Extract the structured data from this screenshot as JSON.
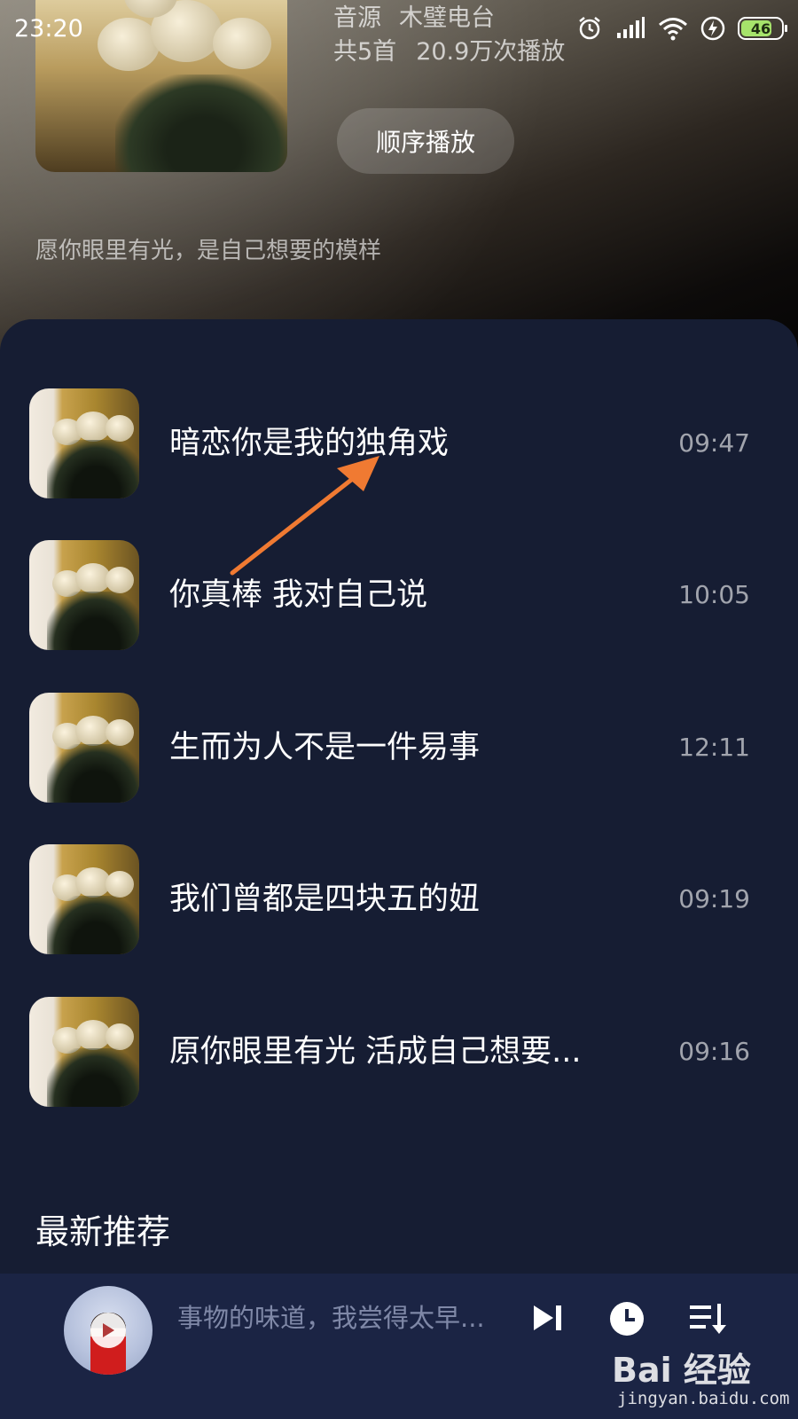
{
  "status_bar": {
    "time": "23:20",
    "battery_level": "46",
    "battery_color": "#a6e36b"
  },
  "album": {
    "source_label": "音源",
    "source_name": "木璧电台",
    "track_count": "共5首",
    "play_count": "20.9万次播放",
    "play_order_label": "顺序播放",
    "description": "愿你眼里有光，是自己想要的模样"
  },
  "songs": [
    {
      "title": "暗恋你是我的独角戏",
      "duration": "09:47"
    },
    {
      "title": "你真棒 我对自己说",
      "duration": "10:05"
    },
    {
      "title": "生而为人不是一件易事",
      "duration": "12:11"
    },
    {
      "title": "我们曾都是四块五的妞",
      "duration": "09:19"
    },
    {
      "title": "原你眼里有光 活成自己想要...",
      "duration": "09:16"
    }
  ],
  "section": {
    "latest_title": "最新推荐"
  },
  "player": {
    "now_playing": "事物的味道，我尝得太早..."
  },
  "watermark": {
    "logo_text": "Bai 经验",
    "url": "jingyan.baidu.com"
  },
  "colors": {
    "panel_bg": "#161d33",
    "player_bg": "#1b2444",
    "arrow": "#f07a32"
  }
}
